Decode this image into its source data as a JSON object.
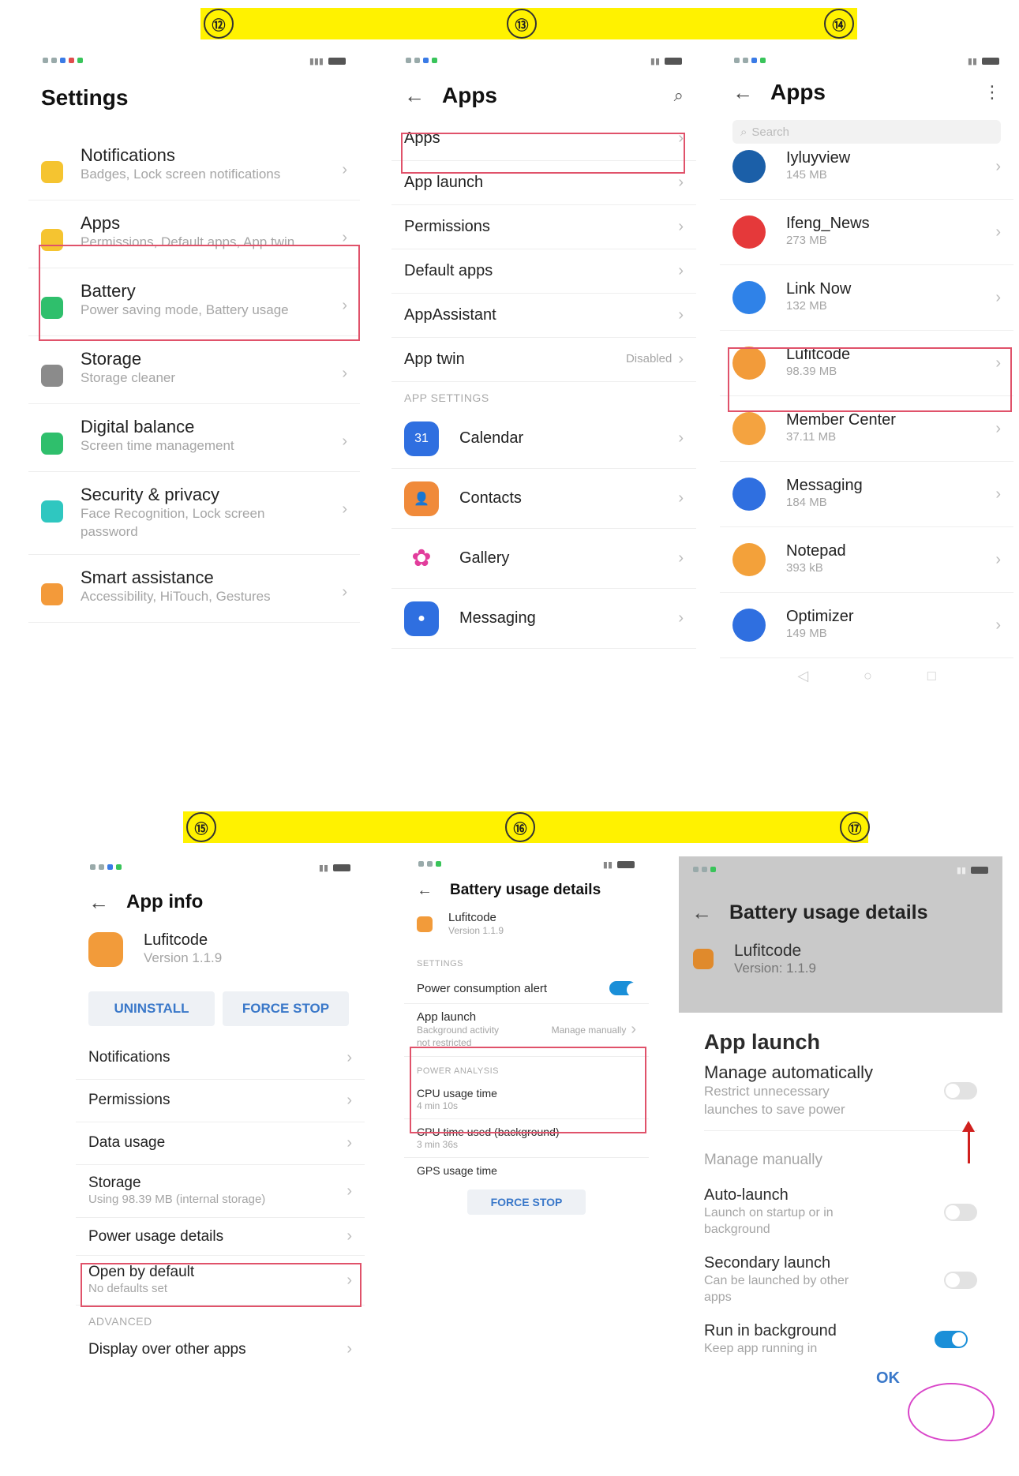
{
  "steps_top": [
    "⑫",
    "⑬",
    "⑭"
  ],
  "steps_bottom": [
    "⑮",
    "⑯",
    "⑰"
  ],
  "icons": {
    "back": "back-arrow-icon",
    "search": "search-icon",
    "more": "more-vert-icon",
    "chevron": "chevron-right-icon"
  },
  "colors": {
    "highlight": "#e0526a",
    "step_bar": "#fff200",
    "toggle_on": "#1a8fd8",
    "circle": "#d946c9"
  },
  "screen1": {
    "title": "Settings",
    "items": [
      {
        "title": "Notifications",
        "sub": "Badges, Lock screen notifications",
        "color": "#f5c430"
      },
      {
        "title": "Apps",
        "sub": "Permissions, Default apps, App twin",
        "color": "#f5c430"
      },
      {
        "title": "Battery",
        "sub": "Power saving mode, Battery usage",
        "color": "#2fbf6c"
      },
      {
        "title": "Storage",
        "sub": "Storage cleaner",
        "color": "#8b8b8b"
      },
      {
        "title": "Digital balance",
        "sub": "Screen time management",
        "color": "#2fbf6c"
      },
      {
        "title": "Security & privacy",
        "sub": "Face Recognition, Lock screen password",
        "color": "#2fc7c0"
      },
      {
        "title": "Smart assistance",
        "sub": "Accessibility, HiTouch, Gestures",
        "color": "#f39a3a"
      }
    ]
  },
  "screen2": {
    "title": "Apps",
    "items": [
      "Apps",
      "App launch",
      "Permissions",
      "Default apps",
      "AppAssistant",
      "App twin"
    ],
    "app_twin_value": "Disabled",
    "section": "APP SETTINGS",
    "apps": [
      {
        "name": "Calendar",
        "color": "#2f6fe0",
        "glyph": "31"
      },
      {
        "name": "Contacts",
        "color": "#f08a3a",
        "glyph": "👤"
      },
      {
        "name": "Gallery",
        "color": "#ffffff",
        "glyph": "✿"
      },
      {
        "name": "Messaging",
        "color": "#2f6fe0",
        "glyph": "●"
      }
    ]
  },
  "screen3": {
    "title": "Apps",
    "search_placeholder": "Search",
    "apps": [
      {
        "name": "Iyluyview",
        "size": "145 MB",
        "color": "#1b5fa8"
      },
      {
        "name": "Ifeng_News",
        "size": "273 MB",
        "color": "#e5393a"
      },
      {
        "name": "Link Now",
        "size": "132 MB",
        "color": "#2f82e8"
      },
      {
        "name": "Lufitcode",
        "size": "98.39 MB",
        "color": "#f29b3a"
      },
      {
        "name": "Member Center",
        "size": "37.11 MB",
        "color": "#f4a340"
      },
      {
        "name": "Messaging",
        "size": "184 MB",
        "color": "#2f6fe0"
      },
      {
        "name": "Notepad",
        "size": "393 kB",
        "color": "#f3a13a"
      },
      {
        "name": "Optimizer",
        "size": "149 MB",
        "color": "#2f6fe0"
      }
    ]
  },
  "screen4": {
    "title": "App info",
    "app_name": "Lufitcode",
    "version": "Version 1.1.9",
    "uninstall": "UNINSTALL",
    "force_stop": "FORCE STOP",
    "items": [
      "Notifications",
      "Permissions",
      "Data usage"
    ],
    "storage_title": "Storage",
    "storage_sub": "Using 98.39 MB (internal storage)",
    "power_usage": "Power usage details",
    "open_default": "Open by default",
    "open_default_sub": "No defaults set",
    "advanced": "ADVANCED",
    "display_over": "Display over other apps"
  },
  "screen5": {
    "title": "Battery usage details",
    "app_name": "Lufitcode",
    "version": "Version 1.1.9",
    "settings": "SETTINGS",
    "power_alert": "Power consumption alert",
    "app_launch": "App launch",
    "app_launch_sub": "Background activity not restricted",
    "app_launch_value": "Manage manually",
    "power_analysis": "POWER ANALYSIS",
    "cpu_time": "CPU usage time",
    "cpu_time_val": "4 min 10s",
    "cpu_bg": "CPU time used (background)",
    "cpu_bg_val": "3 min 36s",
    "gps": "GPS usage time",
    "force_stop": "FORCE STOP"
  },
  "screen6": {
    "title": "Battery usage details",
    "app_name": "Lufitcode",
    "version": "Version: 1.1.9",
    "dialog_title": "App launch",
    "manage_auto": "Manage automatically",
    "manage_auto_sub": "Restrict unnecessary launches to save power",
    "manage_manually": "Manage manually",
    "auto_launch": "Auto-launch",
    "auto_launch_sub": "Launch on startup or in background",
    "secondary_launch": "Secondary launch",
    "secondary_launch_sub": "Can be launched by other apps",
    "run_bg": "Run in background",
    "run_bg_sub": "Keep app running in",
    "ok": "OK"
  }
}
